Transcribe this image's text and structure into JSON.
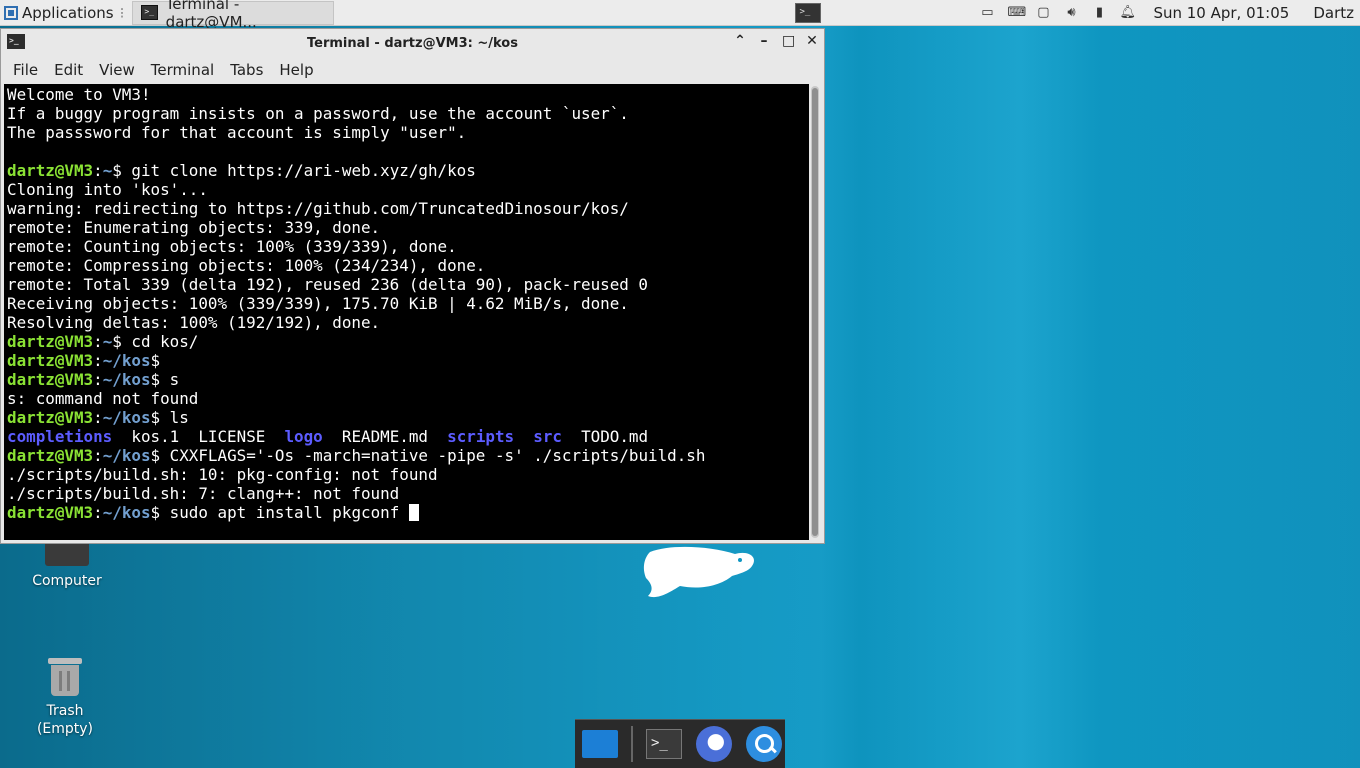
{
  "top_panel": {
    "apps_label": "Applications",
    "apps_sep": "⁝",
    "task_label": "Terminal - dartz@VM...",
    "tray_icons": [
      "network-icon",
      "keyboard-icon",
      "display-icon",
      "volume-icon",
      "battery-icon",
      "notification-icon"
    ],
    "clock": "Sun 10 Apr, 01:05",
    "user": "Dartz"
  },
  "terminal": {
    "title": "Terminal - dartz@VM3: ~/kos",
    "menu": [
      "File",
      "Edit",
      "View",
      "Terminal",
      "Tabs",
      "Help"
    ],
    "lines": [
      [
        {
          "t": "Welcome to VM3!",
          "c": "p-plain"
        }
      ],
      [
        {
          "t": "If a buggy program insists on a password, use the account `user`.",
          "c": "p-plain"
        }
      ],
      [
        {
          "t": "The passsword for that account is simply \"user\".",
          "c": "p-plain"
        }
      ],
      [
        {
          "t": "",
          "c": "p-plain"
        }
      ],
      [
        {
          "t": "dartz@VM3",
          "c": "p-user"
        },
        {
          "t": ":",
          "c": "p-plain"
        },
        {
          "t": "~",
          "c": "p-path"
        },
        {
          "t": "$ git clone https://ari-web.xyz/gh/kos",
          "c": "p-plain"
        }
      ],
      [
        {
          "t": "Cloning into 'kos'...",
          "c": "p-plain"
        }
      ],
      [
        {
          "t": "warning: redirecting to https://github.com/TruncatedDinosour/kos/",
          "c": "p-plain"
        }
      ],
      [
        {
          "t": "remote: Enumerating objects: 339, done.",
          "c": "p-plain"
        }
      ],
      [
        {
          "t": "remote: Counting objects: 100% (339/339), done.",
          "c": "p-plain"
        }
      ],
      [
        {
          "t": "remote: Compressing objects: 100% (234/234), done.",
          "c": "p-plain"
        }
      ],
      [
        {
          "t": "remote: Total 339 (delta 192), reused 236 (delta 90), pack-reused 0",
          "c": "p-plain"
        }
      ],
      [
        {
          "t": "Receiving objects: 100% (339/339), 175.70 KiB | 4.62 MiB/s, done.",
          "c": "p-plain"
        }
      ],
      [
        {
          "t": "Resolving deltas: 100% (192/192), done.",
          "c": "p-plain"
        }
      ],
      [
        {
          "t": "dartz@VM3",
          "c": "p-user"
        },
        {
          "t": ":",
          "c": "p-plain"
        },
        {
          "t": "~",
          "c": "p-path"
        },
        {
          "t": "$ cd kos/",
          "c": "p-plain"
        }
      ],
      [
        {
          "t": "dartz@VM3",
          "c": "p-user"
        },
        {
          "t": ":",
          "c": "p-plain"
        },
        {
          "t": "~/kos",
          "c": "p-path"
        },
        {
          "t": "$",
          "c": "p-plain"
        }
      ],
      [
        {
          "t": "dartz@VM3",
          "c": "p-user"
        },
        {
          "t": ":",
          "c": "p-plain"
        },
        {
          "t": "~/kos",
          "c": "p-path"
        },
        {
          "t": "$ s",
          "c": "p-plain"
        }
      ],
      [
        {
          "t": "s: command not found",
          "c": "p-plain"
        }
      ],
      [
        {
          "t": "dartz@VM3",
          "c": "p-user"
        },
        {
          "t": ":",
          "c": "p-plain"
        },
        {
          "t": "~/kos",
          "c": "p-path"
        },
        {
          "t": "$ ls",
          "c": "p-plain"
        }
      ],
      [
        {
          "t": "completions",
          "c": "dir"
        },
        {
          "t": "  kos.1  LICENSE  ",
          "c": "p-plain"
        },
        {
          "t": "logo",
          "c": "dir"
        },
        {
          "t": "  README.md  ",
          "c": "p-plain"
        },
        {
          "t": "scripts",
          "c": "dir"
        },
        {
          "t": "  ",
          "c": "p-plain"
        },
        {
          "t": "src",
          "c": "dir"
        },
        {
          "t": "  TODO.md",
          "c": "p-plain"
        }
      ],
      [
        {
          "t": "dartz@VM3",
          "c": "p-user"
        },
        {
          "t": ":",
          "c": "p-plain"
        },
        {
          "t": "~/kos",
          "c": "p-path"
        },
        {
          "t": "$ CXXFLAGS='-Os -march=native -pipe -s' ./scripts/build.sh",
          "c": "p-plain"
        }
      ],
      [
        {
          "t": "./scripts/build.sh: 10: pkg-config: not found",
          "c": "p-plain"
        }
      ],
      [
        {
          "t": "./scripts/build.sh: 7: clang++: not found",
          "c": "p-plain"
        }
      ],
      [
        {
          "t": "dartz@VM3",
          "c": "p-user"
        },
        {
          "t": ":",
          "c": "p-plain"
        },
        {
          "t": "~/kos",
          "c": "p-path"
        },
        {
          "t": "$ sudo apt install pkgconf ",
          "c": "p-plain"
        }
      ]
    ]
  },
  "desktop": {
    "computer_label": "Computer",
    "trash_label": "Trash",
    "trash_sub": "(Empty)"
  },
  "dock": {
    "items": [
      "show-desktop-icon",
      "terminal-icon",
      "web-browser-icon",
      "app-finder-icon"
    ]
  },
  "colors": {
    "prompt_user": "#8ae234",
    "prompt_path": "#729fcf",
    "dir": "#5c5cff",
    "desktop": "#0e96c2"
  }
}
